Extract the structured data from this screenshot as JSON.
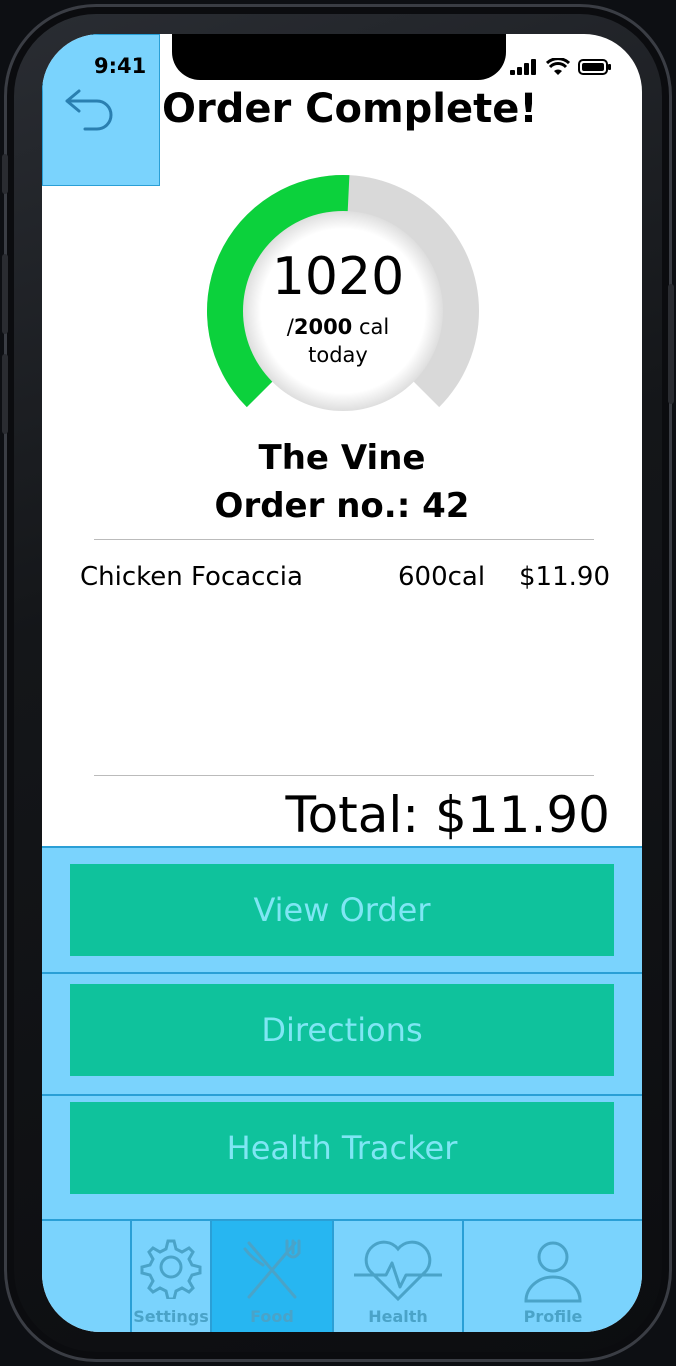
{
  "status_bar": {
    "time": "9:41"
  },
  "header": {
    "title": "Order Complete!",
    "back_icon": "undo-arrow-icon"
  },
  "calories": {
    "consumed": "1020",
    "target_prefix": "/",
    "target": "2000",
    "unit": " cal",
    "period": "today",
    "fraction": 0.51,
    "colors": {
      "progress": "#0cd13c",
      "track": "#d9d9d9"
    }
  },
  "order": {
    "restaurant": "The Vine",
    "number_label": "Order no.: 42",
    "items": [
      {
        "name": "Chicken Focaccia",
        "calories": "600cal",
        "price": "$11.90"
      }
    ],
    "total_label": "Total: $11.90"
  },
  "actions": {
    "view_order": "View Order",
    "directions": "Directions",
    "health_tracker": "Health Tracker"
  },
  "tabbar": {
    "tabs": [
      {
        "label": "Settings",
        "icon": "gear-icon"
      },
      {
        "label": "Food",
        "icon": "fork-knife-icon",
        "active": true
      },
      {
        "label": "Health",
        "icon": "heartbeat-icon"
      },
      {
        "label": "Profile",
        "icon": "person-icon"
      }
    ]
  },
  "colors": {
    "accent_light_blue": "#7ad3fd",
    "button_green": "#0fc29c",
    "button_text": "#7fe6f4",
    "active_tab": "#27b6f1"
  }
}
